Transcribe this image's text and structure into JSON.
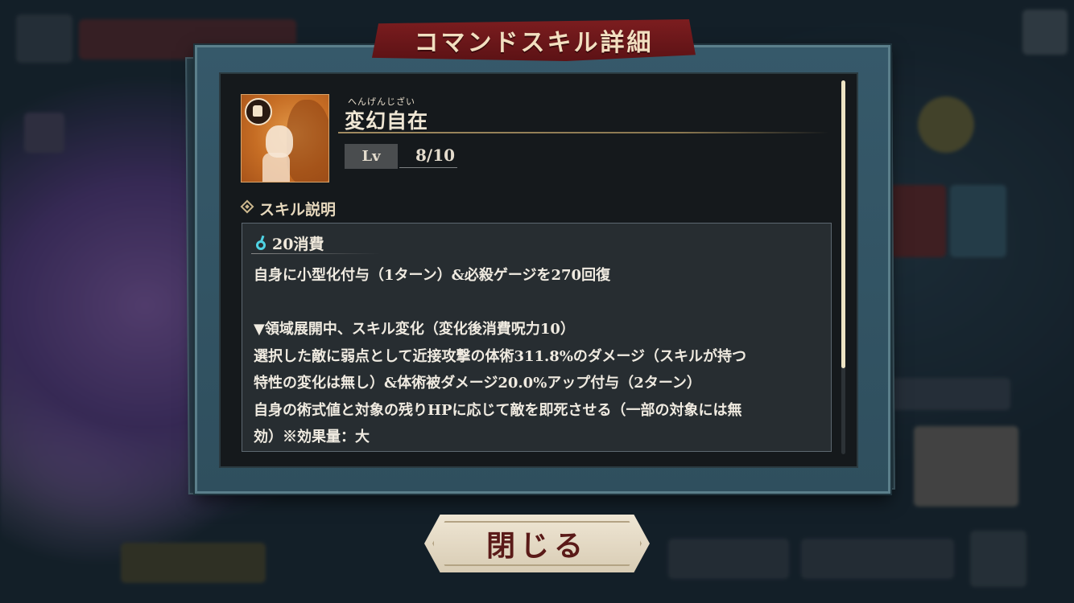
{
  "dialog": {
    "title": "コマンドスキル詳細"
  },
  "skill": {
    "ruby": "へんげんじざい",
    "name": "変幻自在",
    "icon": "skill-portrait-icon",
    "level_label": "Lv",
    "level_value": "8/10"
  },
  "section": {
    "title": "スキル説明",
    "icon": "diamond-bullet-icon"
  },
  "description": {
    "cost_icon": "cursed-energy-icon",
    "cost_text": "20消費",
    "body": "自身に小型化付与（1ターン）&必殺ゲージを270回復\n\n▼領域展開中、スキル変化（変化後消費呪力10）\n選択した敵に弱点として近接攻撃の体術311.8%のダメージ（スキルが持つ\n特性の変化は無し）&体術被ダメージ20.0%アップ付与（2ターン）\n自身の術式値と対象の残りHPに応じて敵を即死させる（一部の対象には無\n効）※効果量：大"
  },
  "buttons": {
    "close_label": "閉じる"
  },
  "colors": {
    "banner": "#7c1d1f",
    "frame": "#36596a",
    "panel": "#15191c",
    "cost_icon": "#4fd2e3"
  }
}
